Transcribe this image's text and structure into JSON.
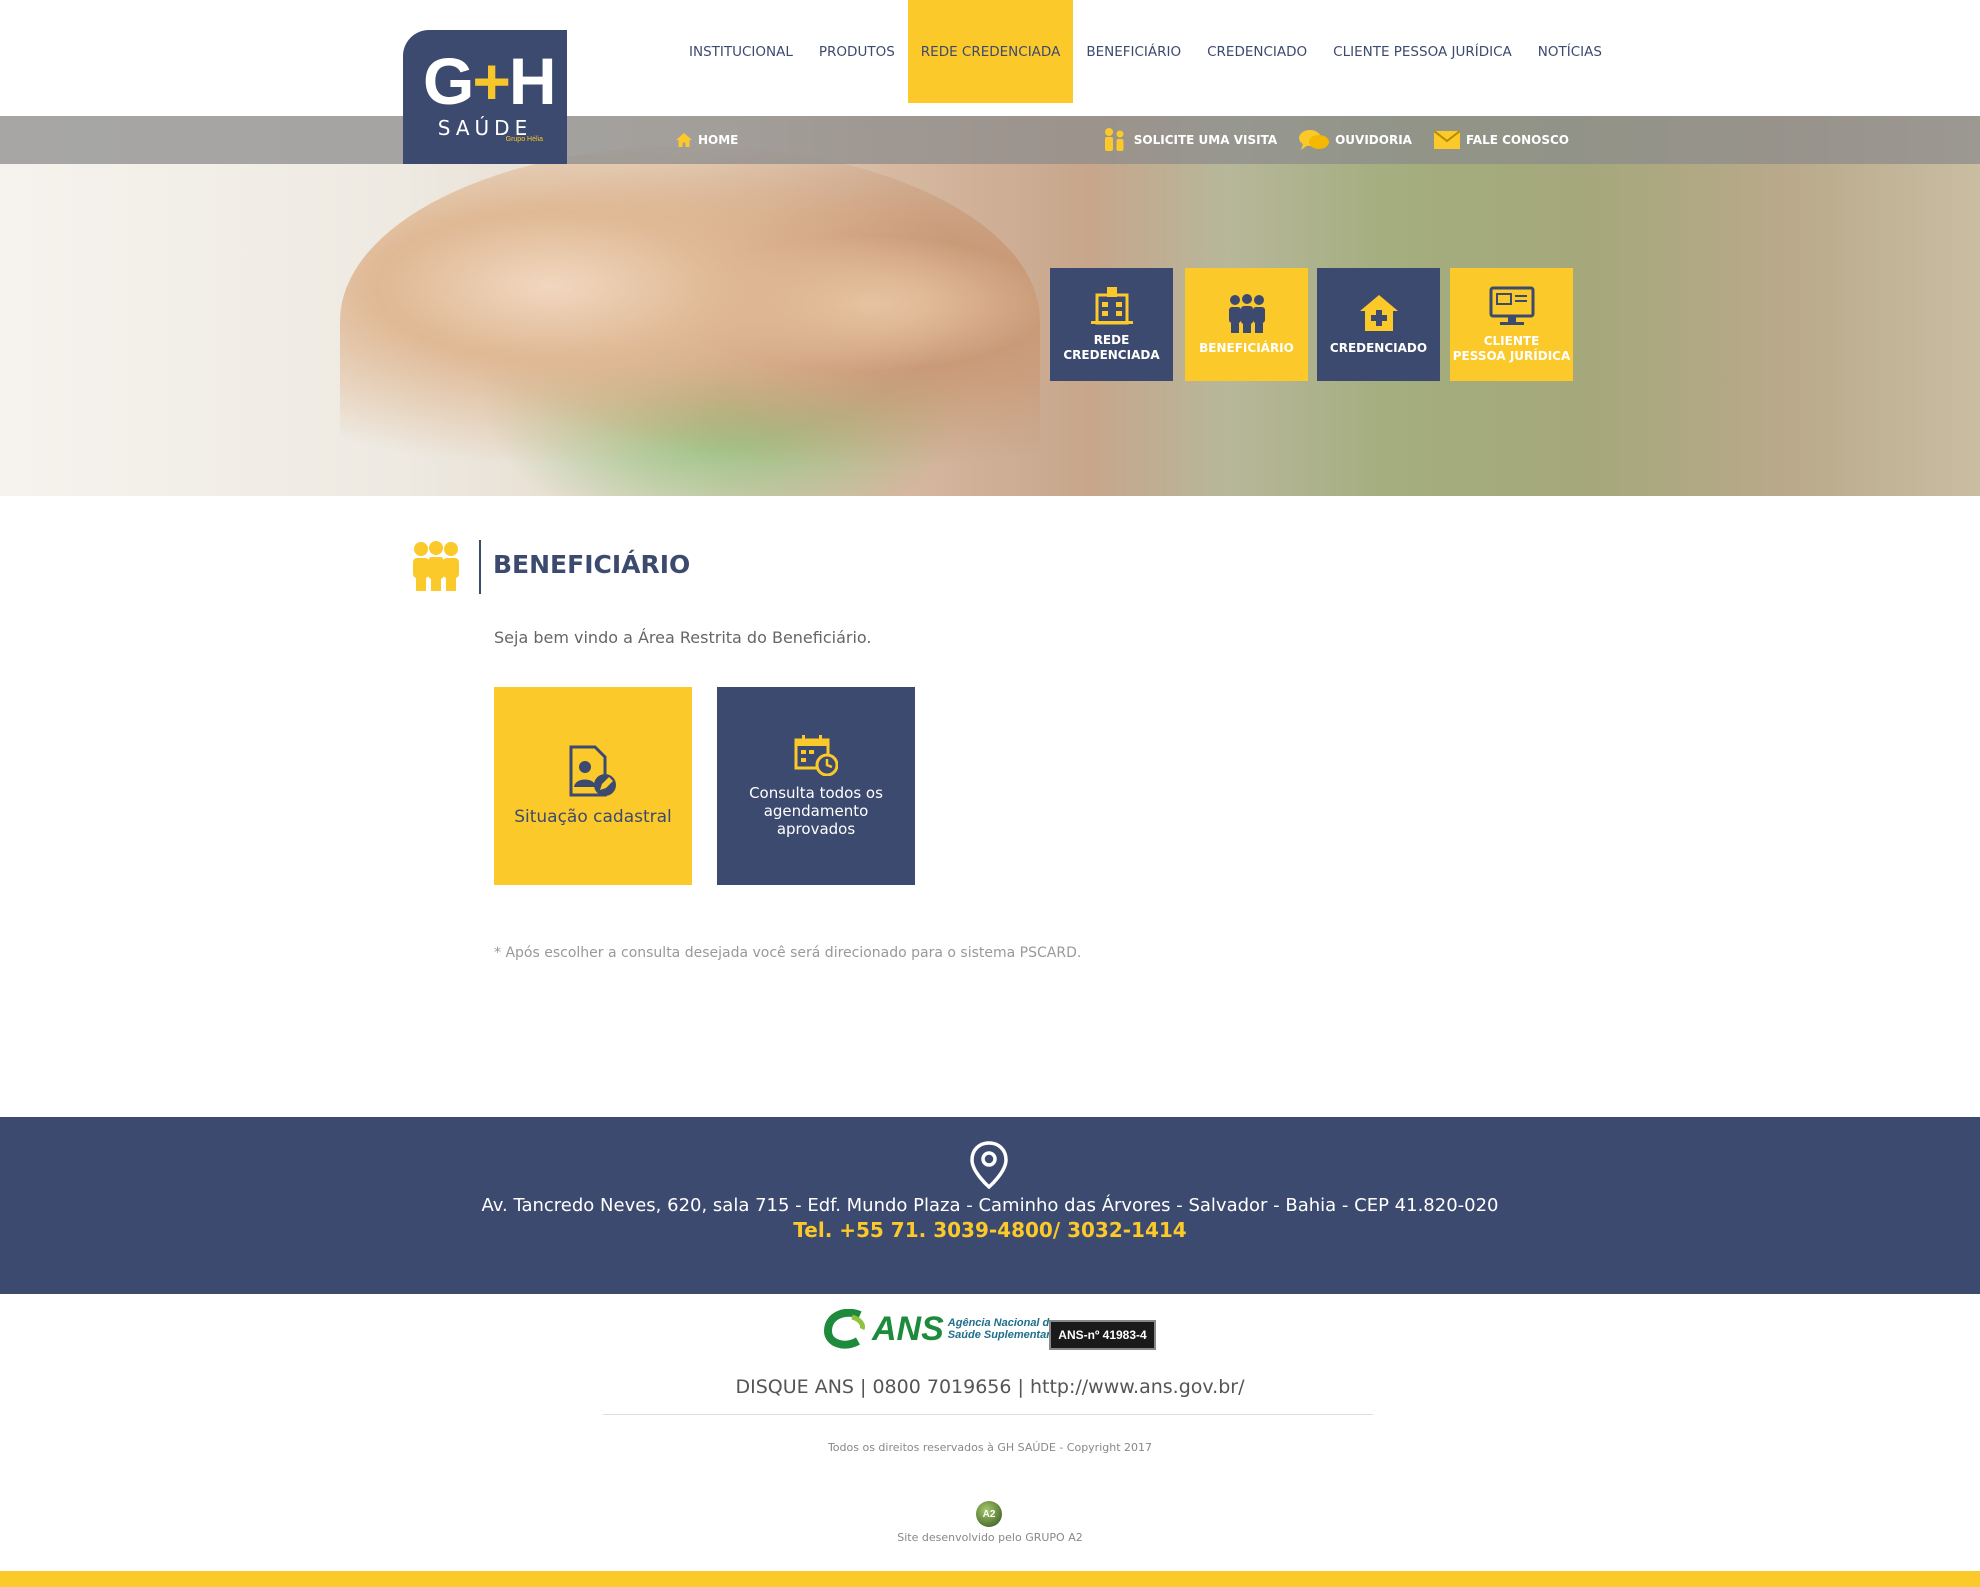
{
  "brand": {
    "logo_letters_left": "G",
    "logo_plus": "+",
    "logo_letters_right": "H",
    "logo_sub": "SAÚDE",
    "logo_group": "Grupo Hélia",
    "primary_color": "#3d4a6f",
    "accent_color": "#fcc92a"
  },
  "nav": {
    "items": [
      {
        "label": "INSTITUCIONAL"
      },
      {
        "label": "PRODUTOS"
      },
      {
        "label": "REDE CREDENCIADA",
        "active": true
      },
      {
        "label": "BENEFICIÁRIO"
      },
      {
        "label": "CREDENCIADO"
      },
      {
        "label": "CLIENTE PESSOA JURÍDICA"
      },
      {
        "label": "NOTÍCIAS"
      }
    ]
  },
  "subbar": {
    "home": "HOME",
    "links": [
      {
        "label": "SOLICITE UMA VISITA",
        "icon": "visitors-icon"
      },
      {
        "label": "OUVIDORIA",
        "icon": "chat-icon"
      },
      {
        "label": "FALE CONOSCO",
        "icon": "envelope-icon"
      }
    ]
  },
  "quick_access": [
    {
      "label_line1": "REDE",
      "label_line2": "CREDENCIADA",
      "icon": "hospital-icon"
    },
    {
      "label_line1": "BENEFICIÁRIO",
      "label_line2": "",
      "icon": "people-icon"
    },
    {
      "label_line1": "CREDENCIADO",
      "label_line2": "",
      "icon": "house-plus-icon"
    },
    {
      "label_line1": "CLIENTE",
      "label_line2": "PESSOA JURÍDICA",
      "icon": "monitor-icon"
    }
  ],
  "section": {
    "title": "BENEFICIÁRIO",
    "welcome": "Seja bem vindo a Área Restrita do Beneficiário.",
    "cards": [
      {
        "label": "Situação cadastral",
        "icon": "profile-edit-icon"
      },
      {
        "label": "Consulta todos os agendamento aprovados",
        "icon": "calendar-clock-icon"
      }
    ],
    "note": "* Após escolher a consulta desejada você será direcionado para o sistema PSCARD."
  },
  "footer": {
    "address": "Av. Tancredo Neves, 620, sala 715 - Edf. Mundo Plaza - Caminho das Árvores - Salvador - Bahia - CEP 41.820-020",
    "tel": "Tel. +55 71. 3039-4800/ 3032-1414",
    "ans_big": "ANS",
    "ans_sub1": "Agência Nacional de",
    "ans_sub2": "Saúde Suplementar",
    "ans_badge": "ANS-nº 41983-4",
    "disque": "DISQUE ANS | 0800 7019656 | http://www.ans.gov.br/",
    "copyright": "Todos os direitos reservados à GH SAÚDE - Copyright 2017",
    "a2_mark": "A2",
    "developer": "Site desenvolvido pelo GRUPO A2"
  }
}
